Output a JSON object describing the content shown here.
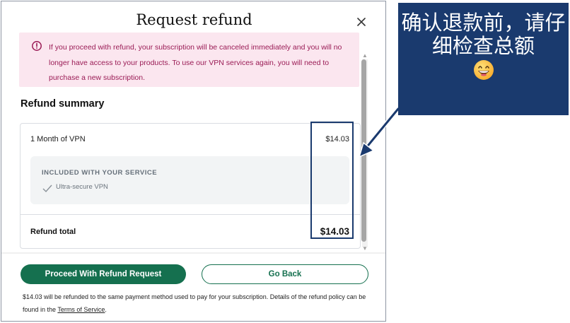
{
  "modal": {
    "title": "Request refund",
    "alert_text": "If you proceed with refund, your subscription will be canceled immediately and you will no longer have access to your products. To use our VPN services again, you will need to purchase a new subscription.",
    "summary_title": "Refund summary",
    "item_name": "1 Month of VPN",
    "item_price": "$14.03",
    "included_title": "INCLUDED WITH YOUR SERVICE",
    "feature": "Ultra-secure VPN",
    "total_label": "Refund total",
    "total_value": "$14.03",
    "primary_button": "Proceed With Refund Request",
    "secondary_button": "Go Back",
    "note_text": "$14.03 will be refunded to the same payment method used to pay for your subscription. Details of the refund policy can be found in the ",
    "note_link": "Terms of Service",
    "note_end": "."
  },
  "annotation": {
    "text": "确认退款前，请仔细检查总额",
    "emoji_icon": "grinning-face-icon"
  },
  "colors": {
    "primary": "#15704f",
    "alert_bg": "#fbe6ef",
    "alert_text": "#9a1b55",
    "annotation_bg": "#1a3a6e"
  }
}
